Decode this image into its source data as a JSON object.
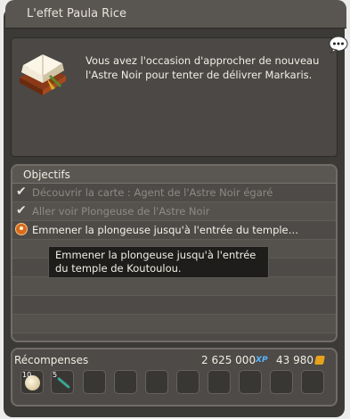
{
  "window": {
    "title": "L'effet Paula Rice"
  },
  "description": "Vous avez l'occasion d'approcher de nouveau l'Astre Noir pour tenter de délivrer Markaris.",
  "objectives": {
    "header": "Objectifs",
    "items": [
      {
        "label": "Découvrir la carte : Agent de l'Astre Noir égaré",
        "status": "done"
      },
      {
        "label": "Aller voir Plongeuse de l'Astre Noir",
        "status": "done"
      },
      {
        "label": "Emmener la plongeuse jusqu'à l'entrée du temple…",
        "status": "active"
      }
    ],
    "tooltip": "Emmener la plongeuse jusqu'à l'entrée du temple de Koutoulou."
  },
  "rewards": {
    "label": "Récompenses",
    "xp_value": "2 625 000",
    "xp_tag": "XP",
    "kamas_value": "43 980",
    "items": [
      {
        "count": "10",
        "icon": "moon-orb-icon"
      },
      {
        "count": "5",
        "icon": "wand-icon"
      }
    ]
  },
  "colors": {
    "window_bg": "#3c3a37",
    "active_text": "#f4f1e8",
    "done_text": "#8d8a85",
    "xp_accent": "#57b6ff",
    "kama_accent": "#e8a11b"
  }
}
